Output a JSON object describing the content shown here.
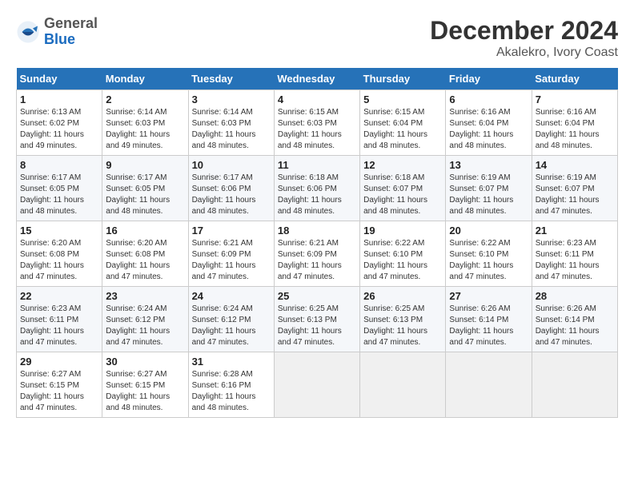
{
  "header": {
    "logo_general": "General",
    "logo_blue": "Blue",
    "month_title": "December 2024",
    "location": "Akalekro, Ivory Coast"
  },
  "weekdays": [
    "Sunday",
    "Monday",
    "Tuesday",
    "Wednesday",
    "Thursday",
    "Friday",
    "Saturday"
  ],
  "weeks": [
    [
      {
        "day": "1",
        "sunrise": "Sunrise: 6:13 AM",
        "sunset": "Sunset: 6:02 PM",
        "daylight": "Daylight: 11 hours and 49 minutes."
      },
      {
        "day": "2",
        "sunrise": "Sunrise: 6:14 AM",
        "sunset": "Sunset: 6:03 PM",
        "daylight": "Daylight: 11 hours and 49 minutes."
      },
      {
        "day": "3",
        "sunrise": "Sunrise: 6:14 AM",
        "sunset": "Sunset: 6:03 PM",
        "daylight": "Daylight: 11 hours and 48 minutes."
      },
      {
        "day": "4",
        "sunrise": "Sunrise: 6:15 AM",
        "sunset": "Sunset: 6:03 PM",
        "daylight": "Daylight: 11 hours and 48 minutes."
      },
      {
        "day": "5",
        "sunrise": "Sunrise: 6:15 AM",
        "sunset": "Sunset: 6:04 PM",
        "daylight": "Daylight: 11 hours and 48 minutes."
      },
      {
        "day": "6",
        "sunrise": "Sunrise: 6:16 AM",
        "sunset": "Sunset: 6:04 PM",
        "daylight": "Daylight: 11 hours and 48 minutes."
      },
      {
        "day": "7",
        "sunrise": "Sunrise: 6:16 AM",
        "sunset": "Sunset: 6:04 PM",
        "daylight": "Daylight: 11 hours and 48 minutes."
      }
    ],
    [
      {
        "day": "8",
        "sunrise": "Sunrise: 6:17 AM",
        "sunset": "Sunset: 6:05 PM",
        "daylight": "Daylight: 11 hours and 48 minutes."
      },
      {
        "day": "9",
        "sunrise": "Sunrise: 6:17 AM",
        "sunset": "Sunset: 6:05 PM",
        "daylight": "Daylight: 11 hours and 48 minutes."
      },
      {
        "day": "10",
        "sunrise": "Sunrise: 6:17 AM",
        "sunset": "Sunset: 6:06 PM",
        "daylight": "Daylight: 11 hours and 48 minutes."
      },
      {
        "day": "11",
        "sunrise": "Sunrise: 6:18 AM",
        "sunset": "Sunset: 6:06 PM",
        "daylight": "Daylight: 11 hours and 48 minutes."
      },
      {
        "day": "12",
        "sunrise": "Sunrise: 6:18 AM",
        "sunset": "Sunset: 6:07 PM",
        "daylight": "Daylight: 11 hours and 48 minutes."
      },
      {
        "day": "13",
        "sunrise": "Sunrise: 6:19 AM",
        "sunset": "Sunset: 6:07 PM",
        "daylight": "Daylight: 11 hours and 48 minutes."
      },
      {
        "day": "14",
        "sunrise": "Sunrise: 6:19 AM",
        "sunset": "Sunset: 6:07 PM",
        "daylight": "Daylight: 11 hours and 47 minutes."
      }
    ],
    [
      {
        "day": "15",
        "sunrise": "Sunrise: 6:20 AM",
        "sunset": "Sunset: 6:08 PM",
        "daylight": "Daylight: 11 hours and 47 minutes."
      },
      {
        "day": "16",
        "sunrise": "Sunrise: 6:20 AM",
        "sunset": "Sunset: 6:08 PM",
        "daylight": "Daylight: 11 hours and 47 minutes."
      },
      {
        "day": "17",
        "sunrise": "Sunrise: 6:21 AM",
        "sunset": "Sunset: 6:09 PM",
        "daylight": "Daylight: 11 hours and 47 minutes."
      },
      {
        "day": "18",
        "sunrise": "Sunrise: 6:21 AM",
        "sunset": "Sunset: 6:09 PM",
        "daylight": "Daylight: 11 hours and 47 minutes."
      },
      {
        "day": "19",
        "sunrise": "Sunrise: 6:22 AM",
        "sunset": "Sunset: 6:10 PM",
        "daylight": "Daylight: 11 hours and 47 minutes."
      },
      {
        "day": "20",
        "sunrise": "Sunrise: 6:22 AM",
        "sunset": "Sunset: 6:10 PM",
        "daylight": "Daylight: 11 hours and 47 minutes."
      },
      {
        "day": "21",
        "sunrise": "Sunrise: 6:23 AM",
        "sunset": "Sunset: 6:11 PM",
        "daylight": "Daylight: 11 hours and 47 minutes."
      }
    ],
    [
      {
        "day": "22",
        "sunrise": "Sunrise: 6:23 AM",
        "sunset": "Sunset: 6:11 PM",
        "daylight": "Daylight: 11 hours and 47 minutes."
      },
      {
        "day": "23",
        "sunrise": "Sunrise: 6:24 AM",
        "sunset": "Sunset: 6:12 PM",
        "daylight": "Daylight: 11 hours and 47 minutes."
      },
      {
        "day": "24",
        "sunrise": "Sunrise: 6:24 AM",
        "sunset": "Sunset: 6:12 PM",
        "daylight": "Daylight: 11 hours and 47 minutes."
      },
      {
        "day": "25",
        "sunrise": "Sunrise: 6:25 AM",
        "sunset": "Sunset: 6:13 PM",
        "daylight": "Daylight: 11 hours and 47 minutes."
      },
      {
        "day": "26",
        "sunrise": "Sunrise: 6:25 AM",
        "sunset": "Sunset: 6:13 PM",
        "daylight": "Daylight: 11 hours and 47 minutes."
      },
      {
        "day": "27",
        "sunrise": "Sunrise: 6:26 AM",
        "sunset": "Sunset: 6:14 PM",
        "daylight": "Daylight: 11 hours and 47 minutes."
      },
      {
        "day": "28",
        "sunrise": "Sunrise: 6:26 AM",
        "sunset": "Sunset: 6:14 PM",
        "daylight": "Daylight: 11 hours and 47 minutes."
      }
    ],
    [
      {
        "day": "29",
        "sunrise": "Sunrise: 6:27 AM",
        "sunset": "Sunset: 6:15 PM",
        "daylight": "Daylight: 11 hours and 47 minutes."
      },
      {
        "day": "30",
        "sunrise": "Sunrise: 6:27 AM",
        "sunset": "Sunset: 6:15 PM",
        "daylight": "Daylight: 11 hours and 48 minutes."
      },
      {
        "day": "31",
        "sunrise": "Sunrise: 6:28 AM",
        "sunset": "Sunset: 6:16 PM",
        "daylight": "Daylight: 11 hours and 48 minutes."
      },
      null,
      null,
      null,
      null
    ]
  ]
}
